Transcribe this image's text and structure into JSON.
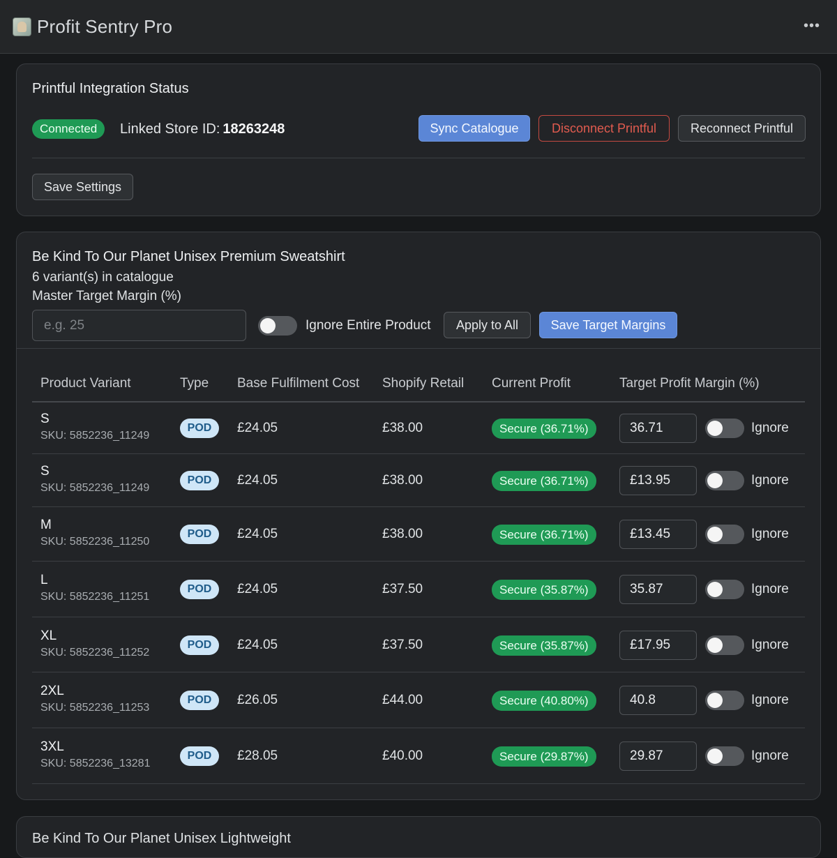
{
  "app": {
    "title": "Profit Sentry Pro",
    "more_icon": "ellipsis-icon",
    "more_label": "•••"
  },
  "integration": {
    "title": "Printful Integration Status",
    "status": "Connected",
    "store_label": "Linked Store ID:",
    "store_id": "18263248",
    "sync_label": "Sync Catalogue",
    "disconnect_label": "Disconnect Printful",
    "reconnect_label": "Reconnect Printful",
    "save_label": "Save Settings",
    "status_color": "#1f9a55"
  },
  "product": {
    "title": "Be Kind To Our Planet Unisex Premium Sweatshirt",
    "variant_count": "6 variant(s) in catalogue",
    "master_label": "Master Target Margin (%)",
    "master_placeholder": "e.g. 25",
    "ignore_product_label": "Ignore Entire Product",
    "apply_all_label": "Apply to All",
    "save_margins_label": "Save Target Margins",
    "columns": [
      "Product Variant",
      "Type",
      "Base Fulfilment Cost",
      "Shopify Retail",
      "Current Profit",
      "Target Profit Margin (%)"
    ],
    "variants": [
      {
        "size": "S",
        "sku": "SKU: 5852236_11249",
        "type": "POD",
        "cost": "£24.05",
        "retail": "£38.00",
        "profit": "Secure (36.71%)",
        "target": "36.71",
        "ignore": "Ignore"
      },
      {
        "size": "S",
        "sku": "SKU: 5852236_11249",
        "type": "POD",
        "cost": "£24.05",
        "retail": "£38.00",
        "profit": "Secure (36.71%)",
        "target": "£13.95",
        "ignore": "Ignore"
      },
      {
        "size": "M",
        "sku": "SKU: 5852236_11250",
        "type": "POD",
        "cost": "£24.05",
        "retail": "£38.00",
        "profit": "Secure (36.71%)",
        "target": "£13.45",
        "ignore": "Ignore"
      },
      {
        "size": "L",
        "sku": "SKU: 5852236_11251",
        "type": "POD",
        "cost": "£24.05",
        "retail": "£37.50",
        "profit": "Secure (35.87%)",
        "target": "35.87",
        "ignore": "Ignore"
      },
      {
        "size": "XL",
        "sku": "SKU: 5852236_11252",
        "type": "POD",
        "cost": "£24.05",
        "retail": "£37.50",
        "profit": "Secure (35.87%)",
        "target": "£17.95",
        "ignore": "Ignore"
      },
      {
        "size": "2XL",
        "sku": "SKU: 5852236_11253",
        "type": "POD",
        "cost": "£26.05",
        "retail": "£44.00",
        "profit": "Secure (40.80%)",
        "target": "40.8",
        "ignore": "Ignore"
      },
      {
        "size": "3XL",
        "sku": "SKU: 5852236_13281",
        "type": "POD",
        "cost": "£28.05",
        "retail": "£40.00",
        "profit": "Secure (29.87%)",
        "target": "29.87",
        "ignore": "Ignore"
      }
    ]
  },
  "next_product": {
    "title": "Be Kind To Our Planet Unisex Lightweight"
  }
}
